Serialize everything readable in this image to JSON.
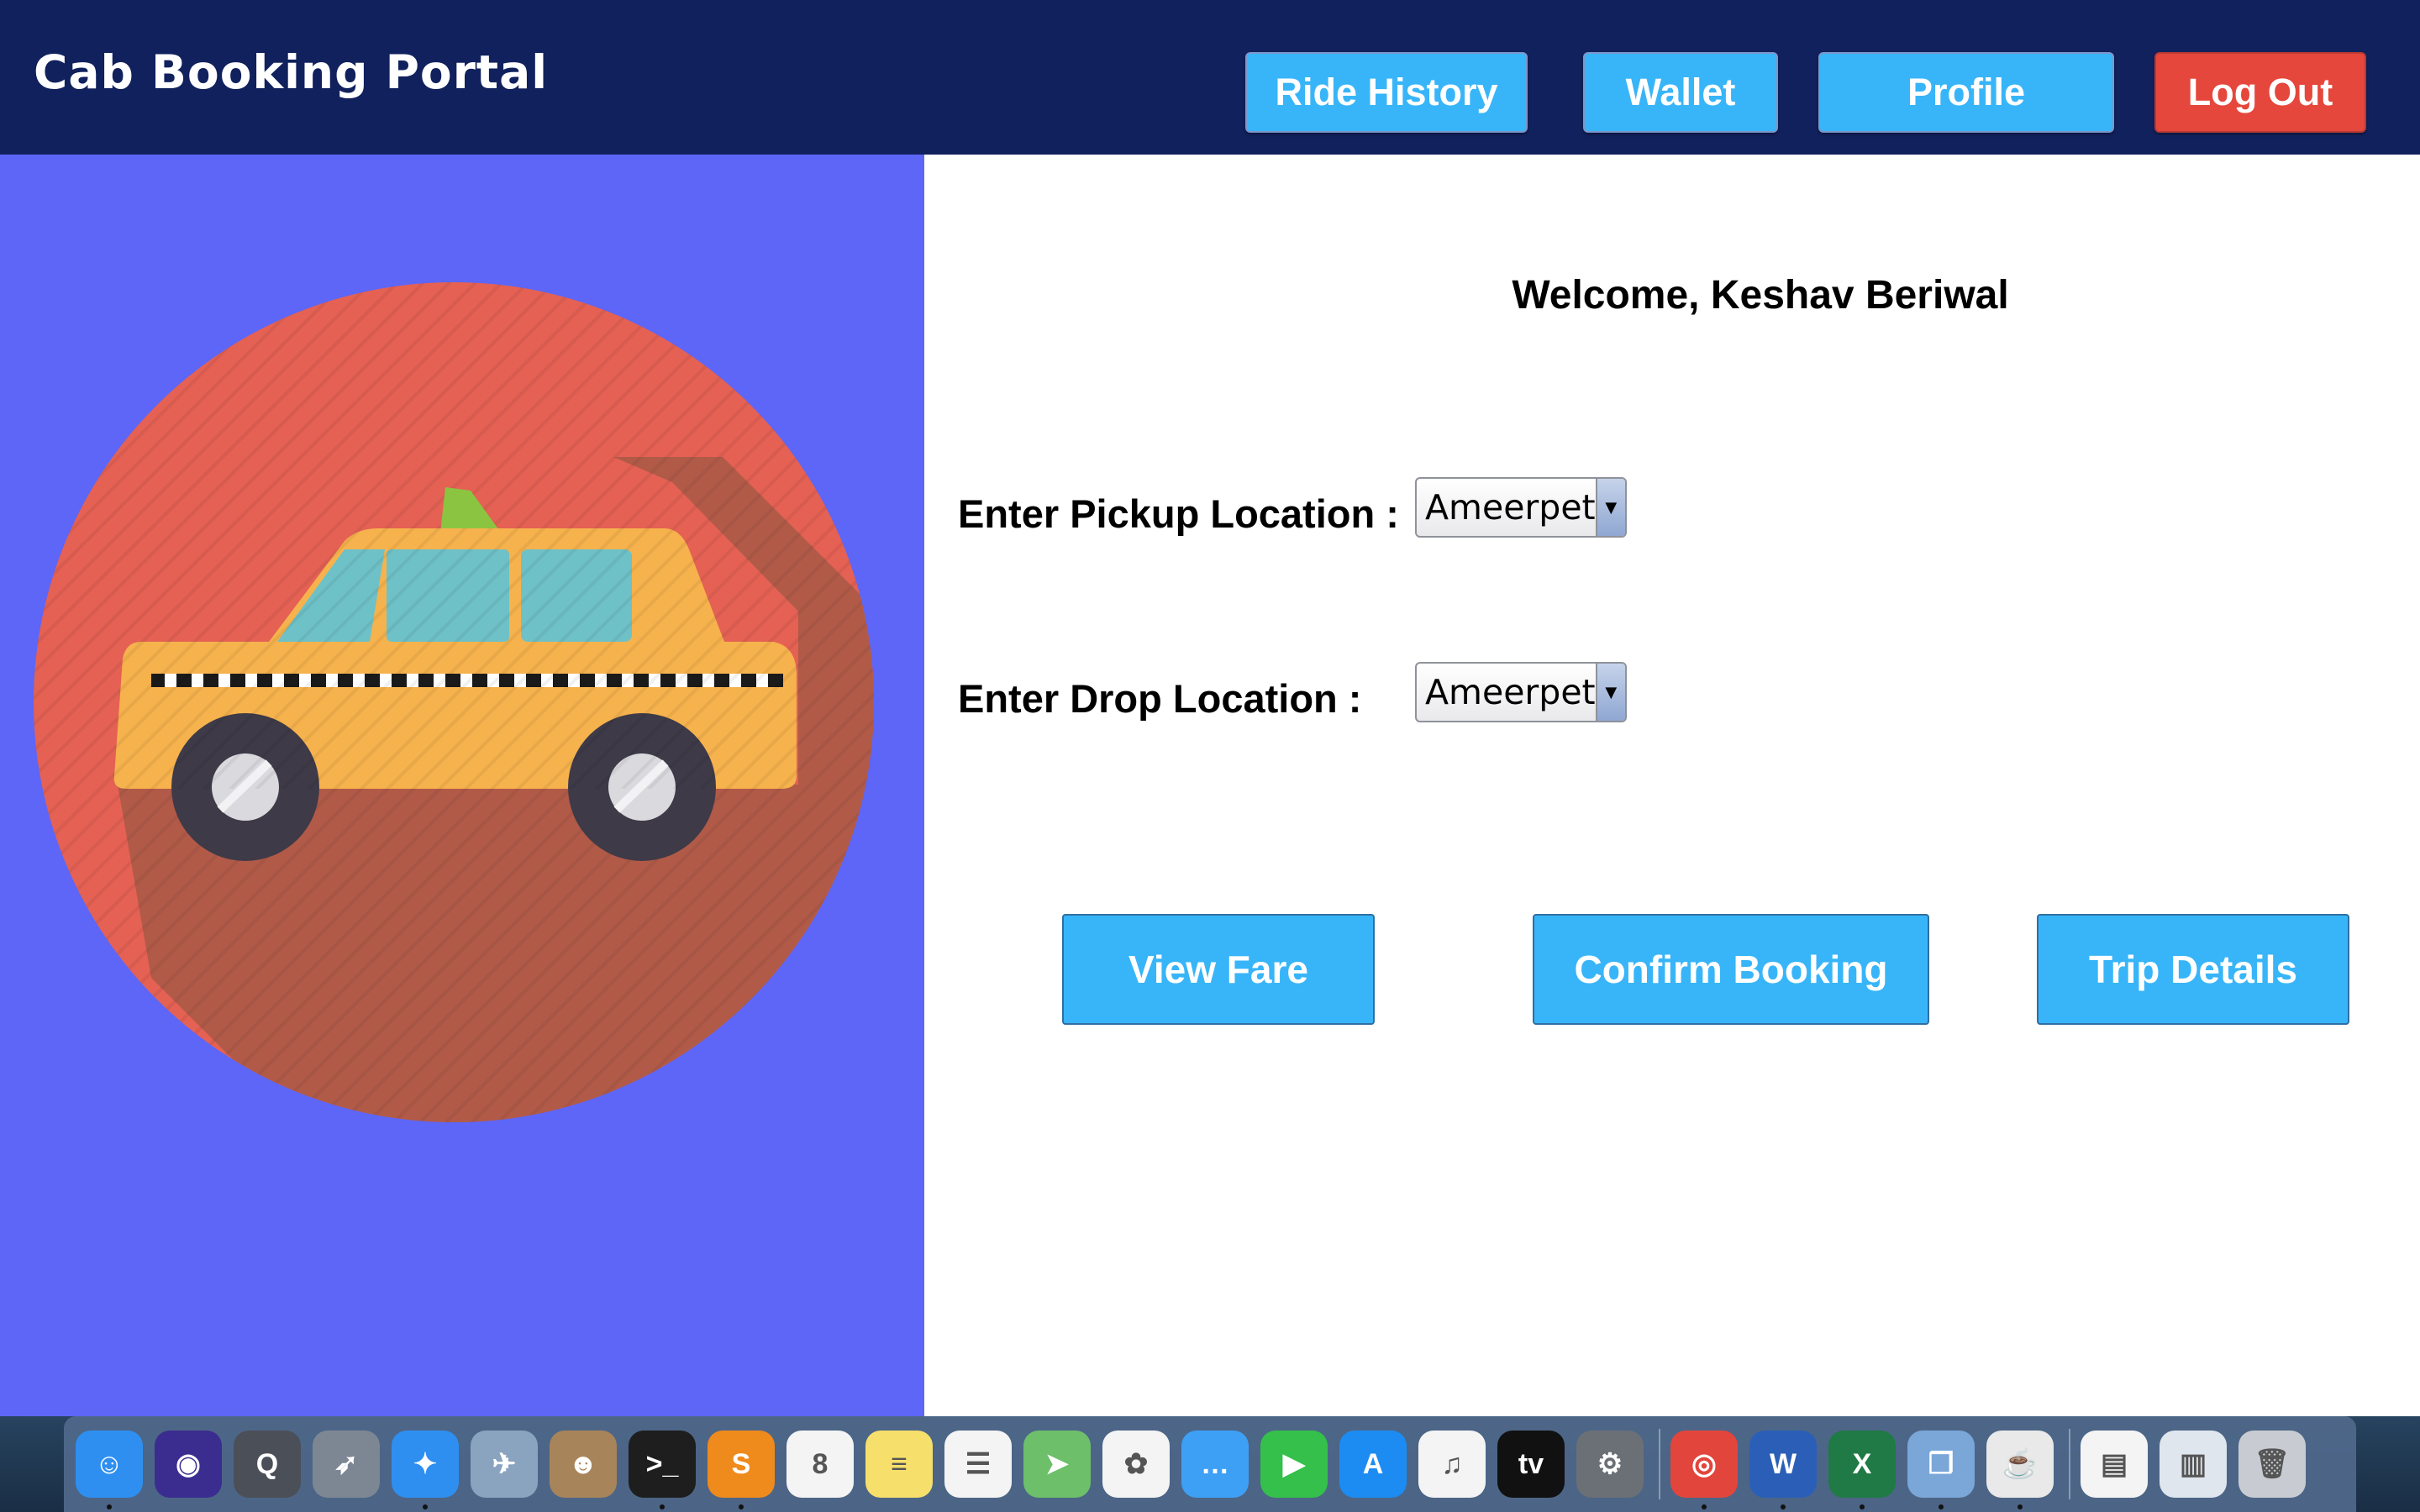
{
  "header": {
    "title": "Cab Booking Portal",
    "ride_history_label": "Ride History",
    "wallet_label": "Wallet",
    "profile_label": "Profile",
    "logout_label": "Log Out"
  },
  "main": {
    "welcome_text": "Welcome, Keshav Beriwal",
    "pickup_label": "Enter Pickup Location :",
    "pickup_value": "Ameerpet",
    "drop_label": "Enter Drop Location :",
    "drop_value": "Ameerpet",
    "view_fare_label": "View Fare",
    "confirm_booking_label": "Confirm Booking",
    "trip_details_label": "Trip Details"
  },
  "colors": {
    "header_bg": "#11215d",
    "accent_blue": "#38b5f8",
    "logout_red": "#e5473c",
    "left_panel_bg": "#5d66f6",
    "circle_red": "#e46154",
    "taxi_yellow": "#f6b24d"
  },
  "dock": {
    "items": [
      {
        "name": "finder-icon",
        "glyph": "☺",
        "color": "#2f8ff0",
        "running": true
      },
      {
        "name": "siri-icon",
        "glyph": "◉",
        "color": "#3b2c8f",
        "running": false
      },
      {
        "name": "quicktime-icon",
        "glyph": "Q",
        "color": "#4b4f58",
        "running": false
      },
      {
        "name": "launchpad-icon",
        "glyph": "➶",
        "color": "#7d8794",
        "running": false
      },
      {
        "name": "safari-icon",
        "glyph": "✦",
        "color": "#2e8ff0",
        "running": true
      },
      {
        "name": "preview-icon",
        "glyph": "✈",
        "color": "#8aa4c0",
        "running": false
      },
      {
        "name": "contacts-icon",
        "glyph": "☻",
        "color": "#a8845a",
        "running": false
      },
      {
        "name": "terminal-icon",
        "glyph": ">_",
        "color": "#1e1e1e",
        "running": true
      },
      {
        "name": "sublime-text-icon",
        "glyph": "S",
        "color": "#ef8a1c",
        "running": true
      },
      {
        "name": "calendar-icon",
        "glyph": "8",
        "color": "#f4f4f4",
        "running": false
      },
      {
        "name": "notes-icon",
        "glyph": "≡",
        "color": "#f7df6b",
        "running": false
      },
      {
        "name": "reminders-icon",
        "glyph": "☰",
        "color": "#f4f4f4",
        "running": false
      },
      {
        "name": "maps-icon",
        "glyph": "➤",
        "color": "#6dbf6a",
        "running": false
      },
      {
        "name": "photos-icon",
        "glyph": "✿",
        "color": "#f4f4f4",
        "running": false
      },
      {
        "name": "messages-icon",
        "glyph": "…",
        "color": "#3ea0f5",
        "running": false
      },
      {
        "name": "facetime-icon",
        "glyph": "▶",
        "color": "#34c04a",
        "running": false
      },
      {
        "name": "app-store-icon",
        "glyph": "A",
        "color": "#1c8cf2",
        "running": false
      },
      {
        "name": "itunes-icon",
        "glyph": "♫",
        "color": "#f4f4f4",
        "running": false
      },
      {
        "name": "apple-tv-icon",
        "glyph": "tv",
        "color": "#111111",
        "running": false
      },
      {
        "name": "system-preferences-icon",
        "glyph": "⚙",
        "color": "#6b7077",
        "running": false
      },
      {
        "name": "separator"
      },
      {
        "name": "chrome-icon",
        "glyph": "◎",
        "color": "#e2453c",
        "running": true
      },
      {
        "name": "word-icon",
        "glyph": "W",
        "color": "#2b5fb7",
        "running": true
      },
      {
        "name": "excel-icon",
        "glyph": "X",
        "color": "#1f7a45",
        "running": true
      },
      {
        "name": "virtualbox-icon",
        "glyph": "❒",
        "color": "#7aa6d8",
        "running": true
      },
      {
        "name": "java-icon",
        "glyph": "☕",
        "color": "#e9e9e9",
        "running": true
      },
      {
        "name": "separator"
      },
      {
        "name": "document-icon",
        "glyph": "▤",
        "color": "#f4f4f4",
        "running": false
      },
      {
        "name": "downloads-stack-icon",
        "glyph": "▥",
        "color": "#dfe6ee",
        "running": false
      },
      {
        "name": "trash-icon",
        "glyph": "🗑",
        "color": "#c8ccd2",
        "running": false
      }
    ]
  }
}
